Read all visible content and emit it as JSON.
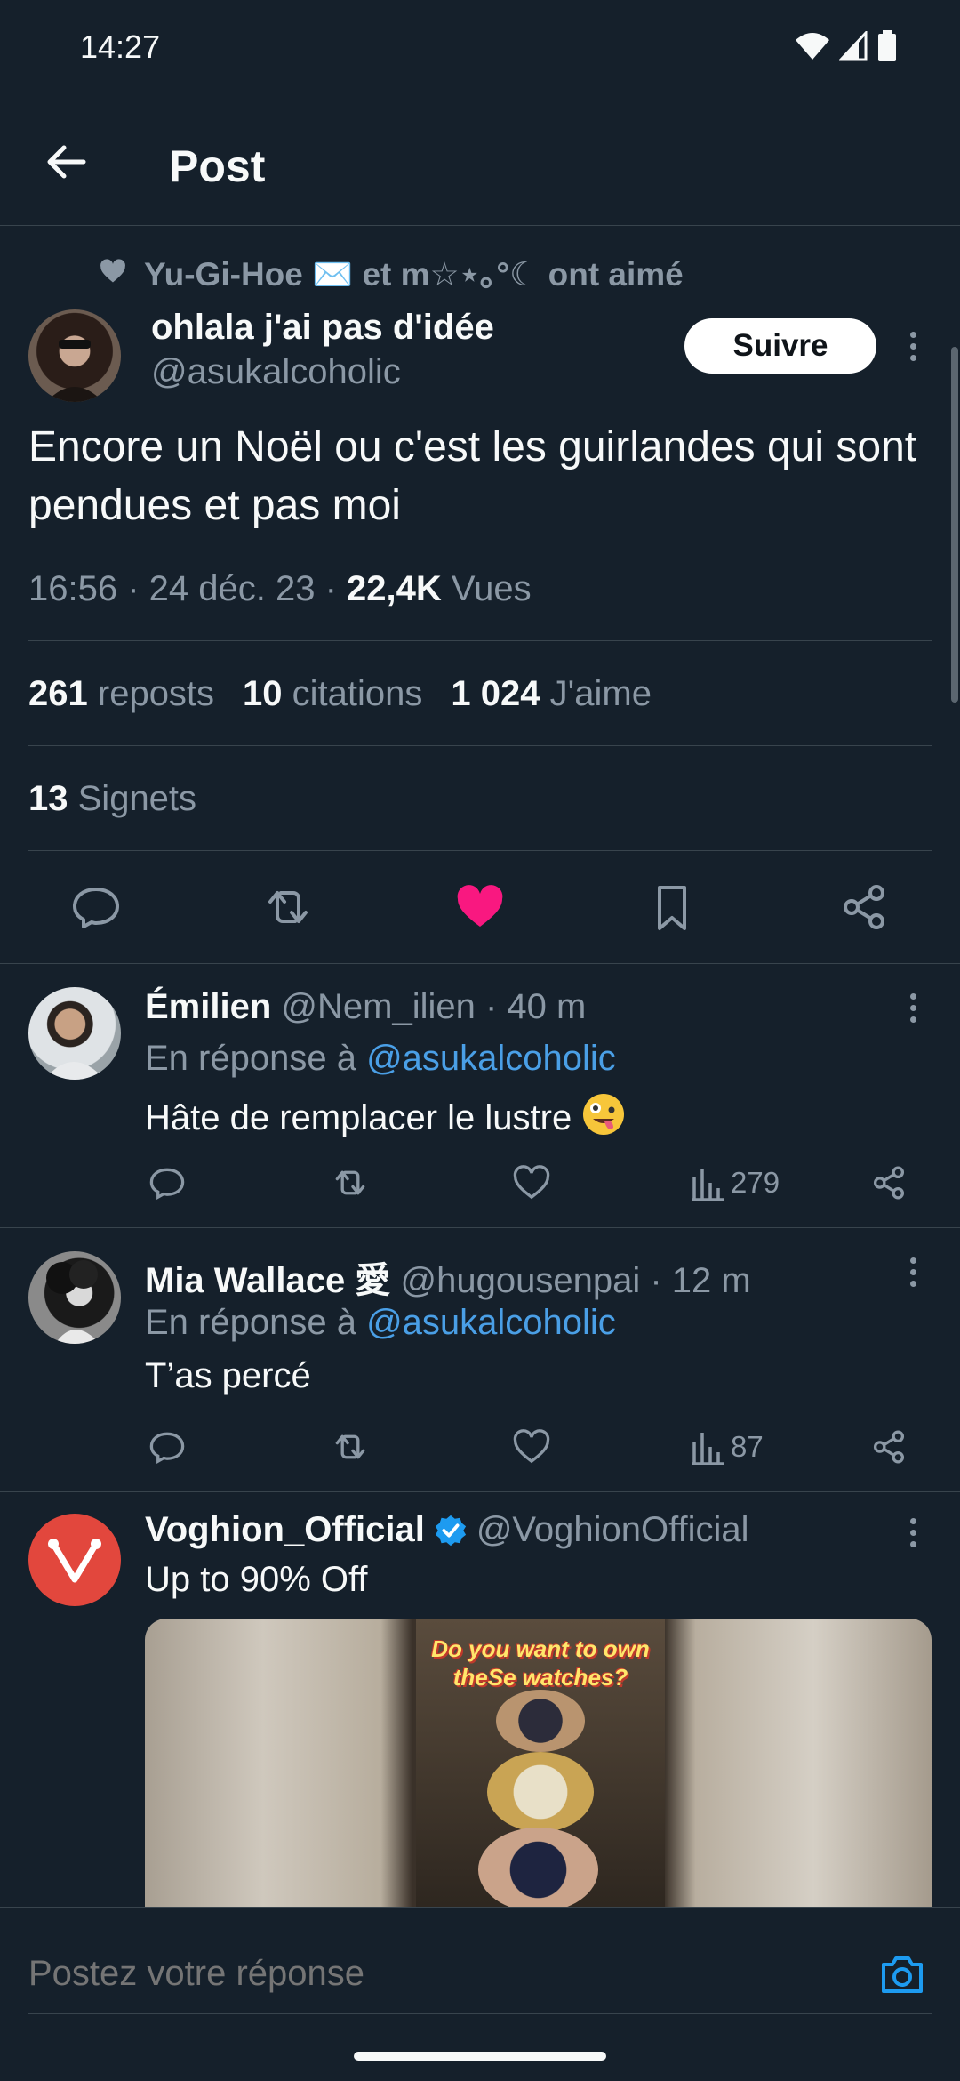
{
  "status_bar": {
    "time": "14:27"
  },
  "header": {
    "title": "Post"
  },
  "post": {
    "liked_by": "Yu-Gi-Hoe ✉️ et m☆⋆｡°☾ ont aimé",
    "author_name": "ohlala j'ai pas d'idée",
    "author_handle": "@asukalcoholic",
    "follow_label": "Suivre",
    "text": "Encore un Noël ou c'est les guirlandes qui sont pendues et pas moi",
    "timestamp": "16:56 · 24 déc. 23 · ",
    "views_count": "22,4K",
    "views_label": " Vues",
    "reposts_count": "261",
    "reposts_label": "reposts",
    "quotes_count": "10",
    "quotes_label": "citations",
    "likes_count": "1 024",
    "likes_label": "J'aime",
    "bookmarks_count": "13",
    "bookmarks_label": "Signets",
    "liked": true,
    "like_color": "#f91880"
  },
  "replies": [
    {
      "name": "Émilien",
      "handle": "@Nem_ilien",
      "time": " · 40 m",
      "in_reply_prefix": "En réponse à ",
      "in_reply_handle": "@asukalcoholic",
      "text": "Hâte de remplacer le lustre",
      "emoji": "zany-face",
      "views": "279"
    },
    {
      "name": "Mia Wallace 愛",
      "handle": "@hugousenpai",
      "time": " · 12 m",
      "in_reply_prefix": "En réponse à ",
      "in_reply_handle": "@asukalcoholic",
      "text": "T’as percé",
      "views": "87"
    }
  ],
  "ad": {
    "name": "Voghion_Official",
    "handle": "@VoghionOfficial",
    "verified": true,
    "text": "Up to 90% Off",
    "image_caption": "Do you want to own theSe watches?",
    "brand_color": "#e2473d"
  },
  "reply_bar": {
    "placeholder": "Postez votre réponse"
  },
  "colors": {
    "background": "#15202b",
    "accent": "#1d9bf0",
    "link": "#4a9fe6"
  }
}
